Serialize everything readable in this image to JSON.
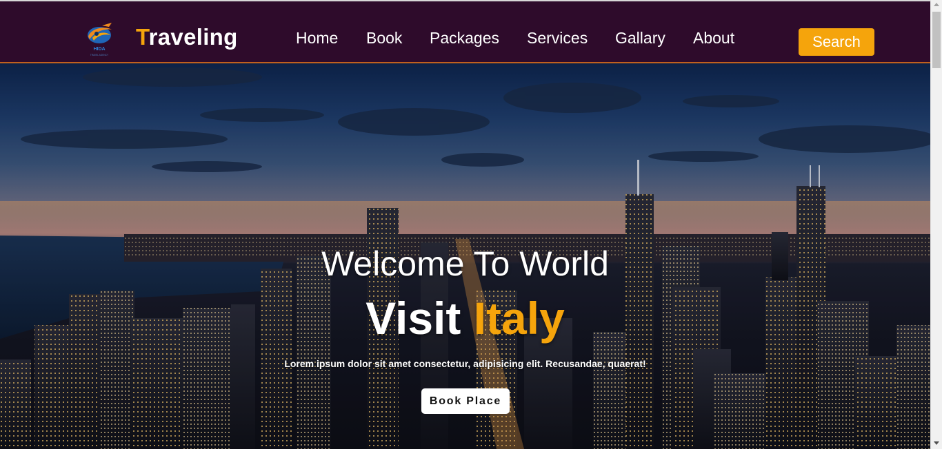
{
  "header": {
    "logo_text": "HIDA",
    "logo_subtext": "TRAVEL AGENCY",
    "brand_first": "T",
    "brand_rest": "raveling",
    "colors": {
      "background": "#2e0b2b",
      "accent": "#f5a40c",
      "border": "#c0611d"
    }
  },
  "nav": {
    "items": [
      {
        "label": "Home"
      },
      {
        "label": "Book"
      },
      {
        "label": "Packages"
      },
      {
        "label": "Services"
      },
      {
        "label": "Gallary"
      },
      {
        "label": "About"
      }
    ],
    "search_label": "Search"
  },
  "hero": {
    "welcome": "Welcome To World",
    "visit_prefix": "Visit",
    "country": "Italy",
    "tagline": "Lorem ipsum dolor sit amet consectetur, adipisicing elit. Recusandae, quaerat!",
    "book_label": "Book Place",
    "background_description_icon": "city-skyline-night-image"
  }
}
